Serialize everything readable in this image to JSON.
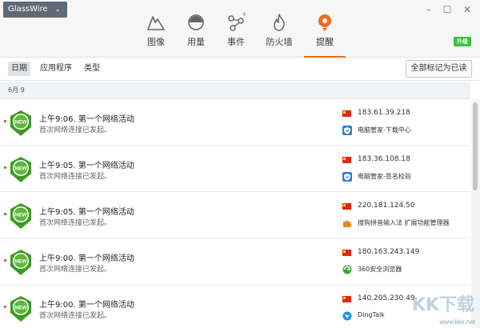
{
  "app": {
    "name": "GlassWire",
    "badge": "升级"
  },
  "window": {
    "minimize": "–",
    "maximize": "☐",
    "close": "✕"
  },
  "nav": {
    "tabs": [
      {
        "label": "图像",
        "icon": "graph-icon"
      },
      {
        "label": "用量",
        "icon": "usage-icon"
      },
      {
        "label": "事件",
        "icon": "events-icon",
        "count": "4"
      },
      {
        "label": "防火墙",
        "icon": "firewall-icon"
      },
      {
        "label": "提醒",
        "icon": "alerts-icon",
        "active": true
      }
    ]
  },
  "filters": {
    "tabs": [
      "日期",
      "应用程序",
      "类型"
    ],
    "active": "日期",
    "mark_all": "全部标记为已读"
  },
  "date_header": "6月 9",
  "alerts": [
    {
      "title": "上午9:06. 第一个网络活动",
      "subtitle": "首次网络连接已发起。",
      "ip": "183.61.39.218",
      "app": "电脑管家-下载中心",
      "app_icon": "shield-icon"
    },
    {
      "title": "上午9:05. 第一个网络活动",
      "subtitle": "首次网络连接已发起。",
      "ip": "183.36.108.18",
      "app": "电脑管家-签名校验",
      "app_icon": "shield-icon"
    },
    {
      "title": "上午9:05. 第一个网络活动",
      "subtitle": "首次网络连接已发起。",
      "ip": "220.181.124.50",
      "app": "搜狗拼音输入法 扩展功能管理器",
      "app_icon": "puzzle-icon"
    },
    {
      "title": "上午9:00. 第一个网络活动",
      "subtitle": "首次网络连接已发起。",
      "ip": "180.163.243.149",
      "app": "360安全浏览器",
      "app_icon": "browser-icon"
    },
    {
      "title": "上午9:00. 第一个网络活动",
      "subtitle": "首次网络连接已发起。",
      "ip": "140.205.230.49",
      "app": "DingTalk",
      "app_icon": "dingtalk-icon"
    }
  ],
  "new_label": "NEW",
  "watermark": {
    "logo": "KK下载",
    "url": "www.kkx.net"
  },
  "colors": {
    "accent": "#f26a1b",
    "badge": "#3cbf3c",
    "new_green": "#3e9a26",
    "flag_red": "#de2910"
  }
}
